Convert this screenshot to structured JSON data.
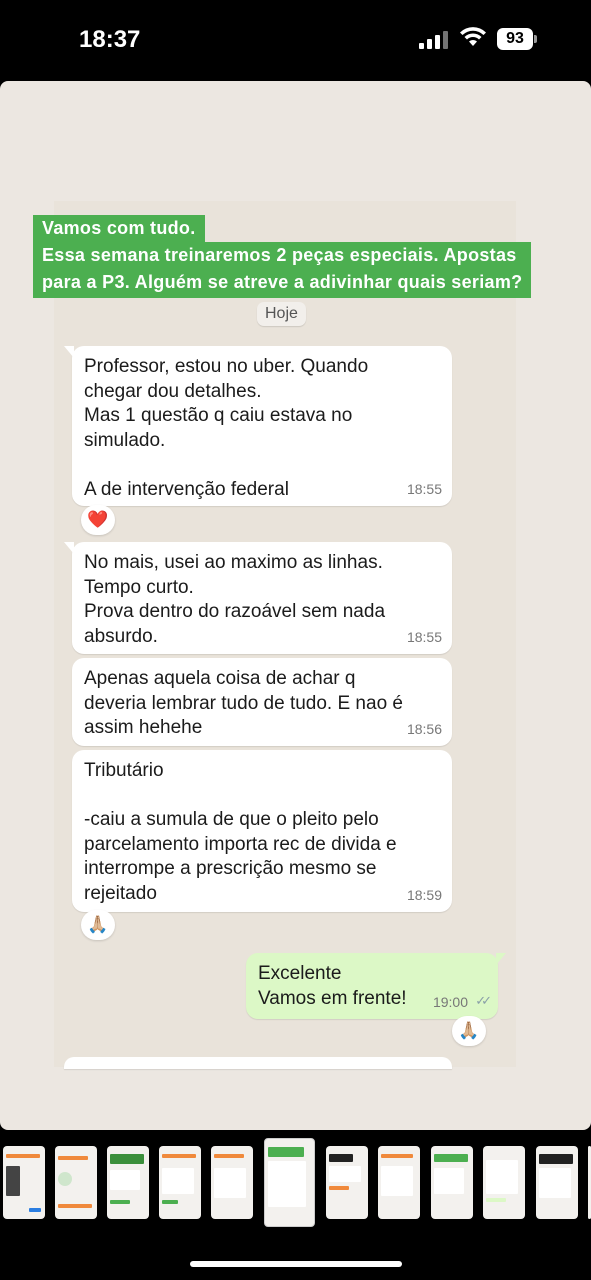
{
  "status": {
    "time": "18:37",
    "battery": "93"
  },
  "caption": {
    "line1": "Vamos com tudo.",
    "line2": "Essa semana treinaremos 2 peças especiais. Apostas",
    "line3": "para a P3. Alguém se atreve a adivinhar quais seriam?"
  },
  "date_label": "Hoje",
  "messages": [
    {
      "text": "Professor, estou no uber. Quando\nchegar dou detalhes.\nMas 1 questão q caiu estava no\nsimulado.\n\nA de intervenção federal",
      "time": "18:55",
      "reaction": "❤️"
    },
    {
      "text": "No mais, usei ao maximo as linhas.\nTempo curto.\nProva dentro do razoável sem nada\nabsurdo.",
      "time": "18:55"
    },
    {
      "text": "Apenas aquela coisa de achar q\ndeveria lembrar tudo de tudo. E nao é\nassim hehehe",
      "time": "18:56"
    },
    {
      "text": "Tributário\n\n-caiu a sumula de que o pleito pelo\nparcelamento importa rec de divida e\ninterrompe a prescrição mesmo se\nrejeitado",
      "time": "18:59",
      "reaction": "🙏🏼"
    },
    {
      "text": "Excelente\nVamos em frente!",
      "time": "19:00",
      "reaction": "🙏🏼",
      "outgoing": true,
      "ticks": "✓✓"
    }
  ],
  "colors": {
    "caption_bg": "#4caf50",
    "outgoing_bubble": "#dcf8c6",
    "incoming_bubble": "#ffffff"
  }
}
